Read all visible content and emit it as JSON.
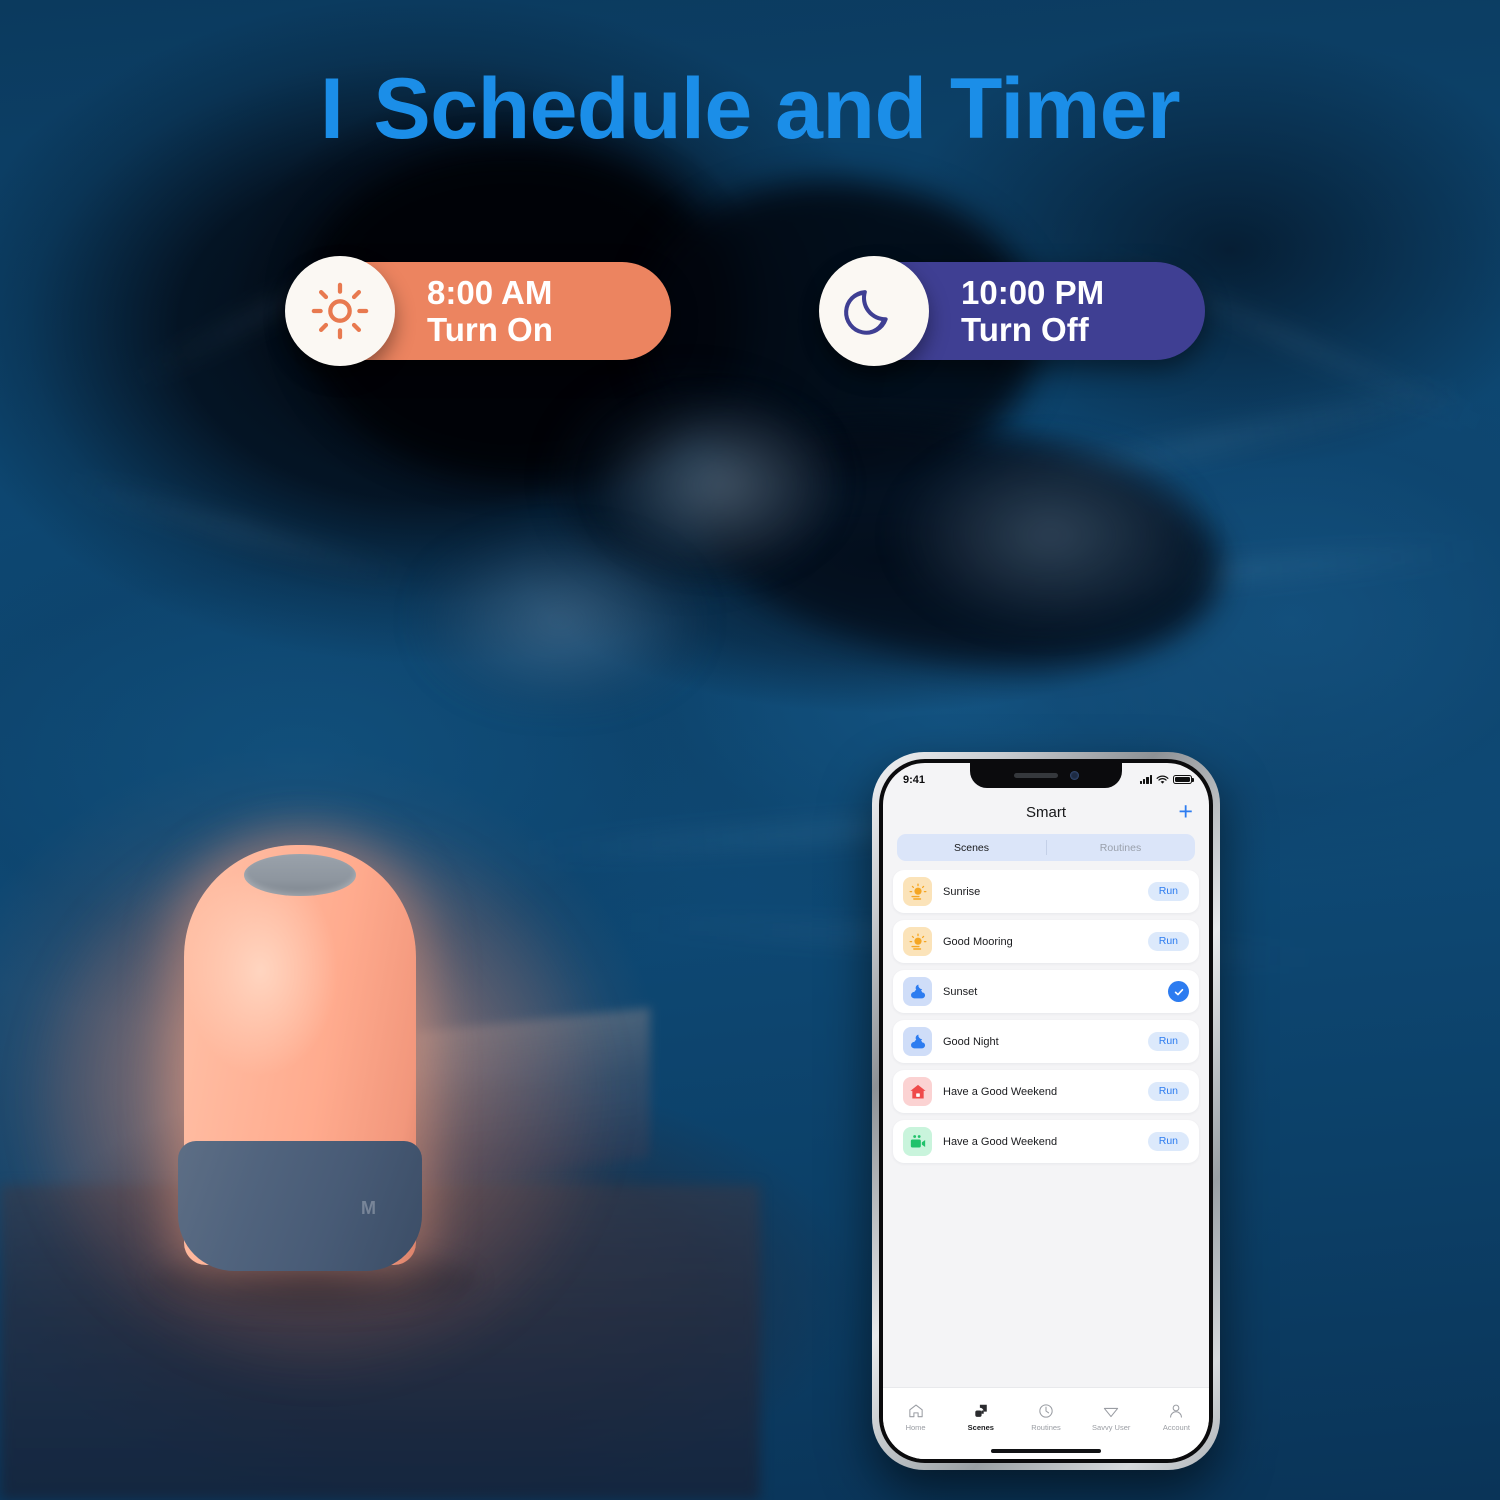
{
  "headline": {
    "bar": "I",
    "text": "Schedule and Timer",
    "color": "#1b8ee8"
  },
  "schedule_pills": [
    {
      "id": "turn-on",
      "icon": "sun-icon",
      "time": "8:00 AM",
      "action": "Turn On",
      "bg": "#ec8460",
      "icon_color": "#e8794f"
    },
    {
      "id": "turn-off",
      "icon": "moon-icon",
      "time": "10:00 PM",
      "action": "Turn Off",
      "bg": "#3f3f93",
      "icon_color": "#3f3f93"
    }
  ],
  "product": {
    "name": "smart-night-lamp",
    "brand_mark": "M"
  },
  "phone": {
    "status_bar": {
      "time": "9:41",
      "signal": "cellular-signal-icon",
      "wifi": "wifi-icon",
      "battery": "battery-icon"
    },
    "nav": {
      "title": "Smart",
      "add_label": "+"
    },
    "segmented": {
      "options": [
        "Scenes",
        "Routines"
      ],
      "selected": "Scenes"
    },
    "scenes": [
      {
        "name": "Sunrise",
        "icon": "sunrise-icon",
        "icon_bg": "#fbe3b9",
        "icon_fg": "#f5a623",
        "action": "Run",
        "state": "idle"
      },
      {
        "name": "Good Mooring",
        "icon": "sunrise-icon",
        "icon_bg": "#fbe3b9",
        "icon_fg": "#f5a623",
        "action": "Run",
        "state": "idle"
      },
      {
        "name": "Sunset",
        "icon": "sunset-icon",
        "icon_bg": "#cfddf8",
        "icon_fg": "#2d7cf0",
        "action": "",
        "state": "active"
      },
      {
        "name": "Good Night",
        "icon": "sunset-icon",
        "icon_bg": "#cfddf8",
        "icon_fg": "#2d7cf0",
        "action": "Run",
        "state": "idle"
      },
      {
        "name": "Have a Good Weekend",
        "icon": "home-icon",
        "icon_bg": "#fbd2d2",
        "icon_fg": "#ef4a4a",
        "action": "Run",
        "state": "idle"
      },
      {
        "name": "Have a Good Weekend",
        "icon": "camera-icon",
        "icon_bg": "#c9f4dc",
        "icon_fg": "#20c26b",
        "action": "Run",
        "state": "idle"
      }
    ],
    "tabs": [
      {
        "label": "Home",
        "icon": "home-outline-icon",
        "active": false
      },
      {
        "label": "Scenes",
        "icon": "scenes-icon",
        "active": true
      },
      {
        "label": "Routines",
        "icon": "clock-icon",
        "active": false
      },
      {
        "label": "Savvy User",
        "icon": "diamond-icon",
        "active": false
      },
      {
        "label": "Account",
        "icon": "person-icon",
        "active": false
      }
    ]
  }
}
